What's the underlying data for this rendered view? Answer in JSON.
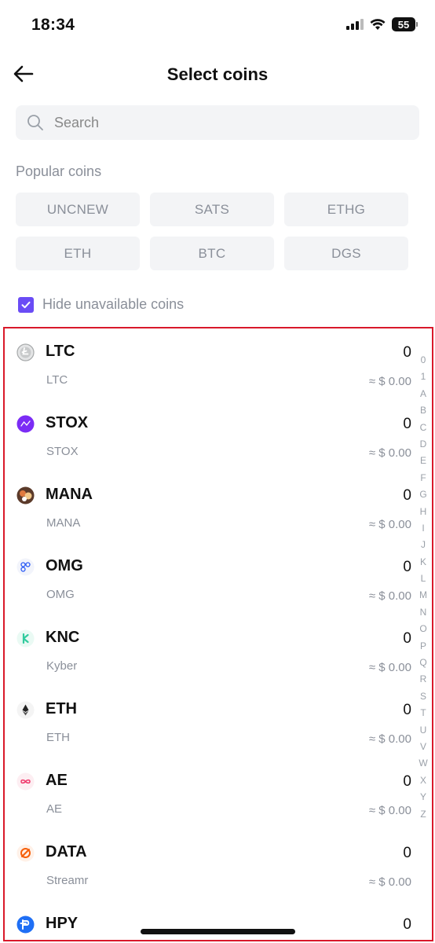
{
  "status_bar": {
    "time": "18:34",
    "battery": "55"
  },
  "header": {
    "title": "Select coins"
  },
  "search": {
    "placeholder": "Search"
  },
  "popular": {
    "title": "Popular coins",
    "chips": [
      "UNCNEW",
      "SATS",
      "ETHG",
      "ETH",
      "BTC",
      "DGS"
    ]
  },
  "hide_unavailable": {
    "label": "Hide unavailable coins",
    "checked": true
  },
  "coins": [
    {
      "symbol": "LTC",
      "name": "LTC",
      "amount": "0",
      "value": "≈ $ 0.00",
      "icon": "litecoin-icon",
      "color": "#a6a9aa"
    },
    {
      "symbol": "STOX",
      "name": "STOX",
      "amount": "0",
      "value": "≈ $ 0.00",
      "icon": "stox-icon",
      "color": "#7b2cf5"
    },
    {
      "symbol": "MANA",
      "name": "MANA",
      "amount": "0",
      "value": "≈ $ 0.00",
      "icon": "mana-icon",
      "color": "#e07a3f"
    },
    {
      "symbol": "OMG",
      "name": "OMG",
      "amount": "0",
      "value": "≈ $ 0.00",
      "icon": "omg-icon",
      "color": "#2c5cf5"
    },
    {
      "symbol": "KNC",
      "name": "Kyber",
      "amount": "0",
      "value": "≈ $ 0.00",
      "icon": "kyber-icon",
      "color": "#31cb9e"
    },
    {
      "symbol": "ETH",
      "name": "ETH",
      "amount": "0",
      "value": "≈ $ 0.00",
      "icon": "ethereum-icon",
      "color": "#222222"
    },
    {
      "symbol": "AE",
      "name": "AE",
      "amount": "0",
      "value": "≈ $ 0.00",
      "icon": "aeternity-icon",
      "color": "#f03c6e"
    },
    {
      "symbol": "DATA",
      "name": "Streamr",
      "amount": "0",
      "value": "≈ $ 0.00",
      "icon": "streamr-icon",
      "color": "#f65f0a"
    },
    {
      "symbol": "HPY",
      "name": "",
      "amount": "0",
      "value": "",
      "icon": "hyper-pay-icon",
      "color": "#1f6ff5"
    }
  ],
  "alpha_index": [
    "0",
    "1",
    "A",
    "B",
    "C",
    "D",
    "E",
    "F",
    "G",
    "H",
    "I",
    "J",
    "K",
    "L",
    "M",
    "N",
    "O",
    "P",
    "Q",
    "R",
    "S",
    "T",
    "U",
    "V",
    "W",
    "X",
    "Y",
    "Z"
  ],
  "colors": {
    "accent": "#6a4cf5",
    "highlight_border": "#d9192a",
    "muted_text": "#8a8f99",
    "chip_bg": "#f3f4f6"
  }
}
